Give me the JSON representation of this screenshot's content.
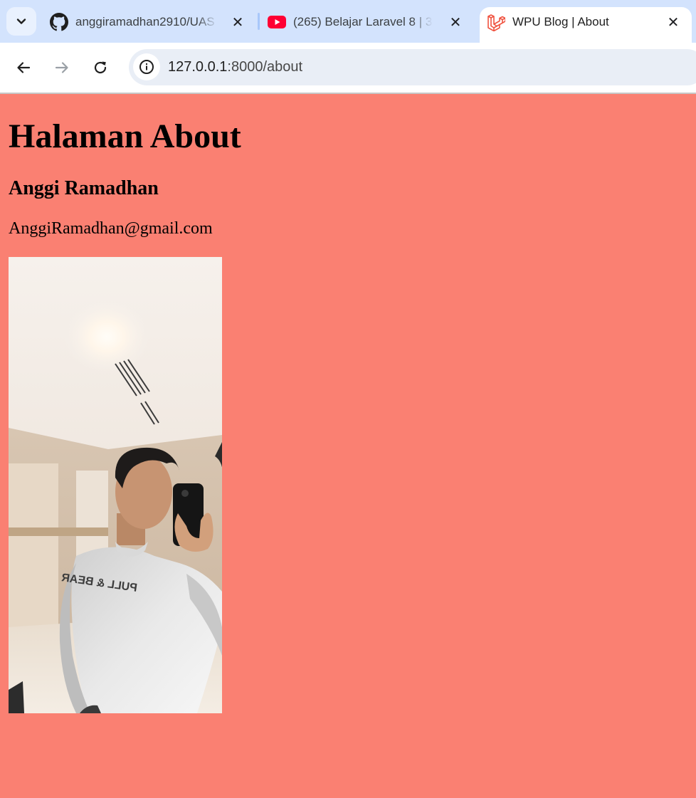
{
  "browser": {
    "tabs": [
      {
        "title": "anggiramadhan2910/UAS",
        "favicon": "github-icon",
        "active": false
      },
      {
        "title": "(265) Belajar Laravel 8 | 3",
        "favicon": "youtube-icon",
        "active": false
      },
      {
        "title": "WPU Blog | About",
        "favicon": "laravel-icon",
        "active": true
      }
    ],
    "close_glyph": "✕",
    "address": {
      "host": "127.0.0.1",
      "path": ":8000/about"
    }
  },
  "page": {
    "heading": "Halaman About",
    "name": "Anggi Ramadhan",
    "email": "AnggiRamadhan@gmail.com",
    "background_color": "#fa8072"
  }
}
